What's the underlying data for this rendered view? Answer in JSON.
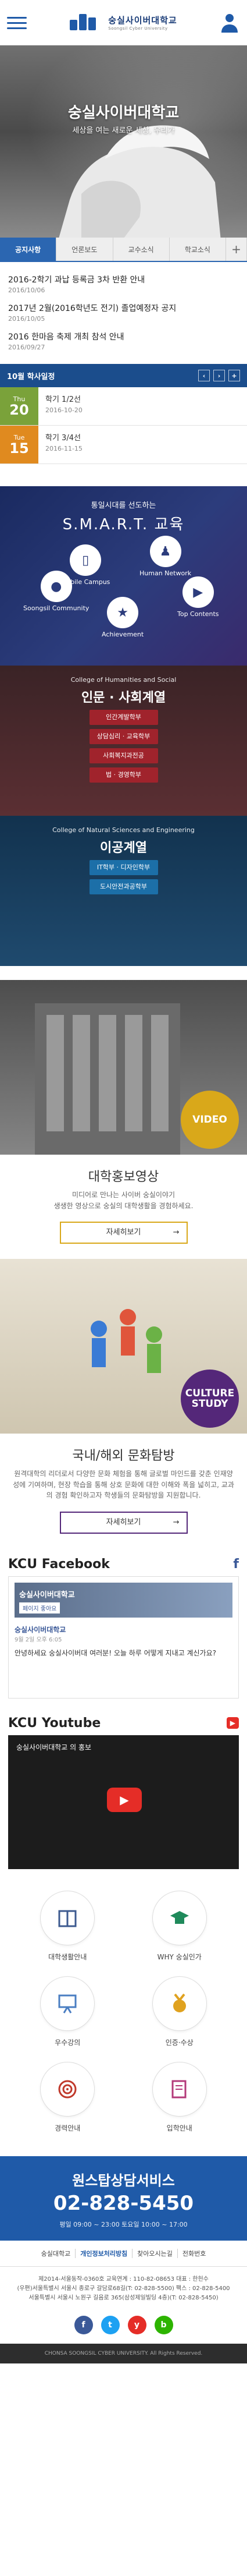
{
  "header": {
    "logo_ko": "숭실사이버대학교",
    "logo_en": "Soongsil Cyber University"
  },
  "hero": {
    "title": "숭실사이버대학교",
    "subtitle": "세상을 여는 새로운 세상, 우리가"
  },
  "tabs": [
    "공지사항",
    "언론보도",
    "교수소식",
    "학교소식",
    "+"
  ],
  "notices": [
    {
      "title": "2016-2학기 과납 등록금 3차 반환 안내",
      "date": "2016/10/06"
    },
    {
      "title": "2017년 2월(2016학년도 전기) 졸업예정자 공지",
      "date": "2016/10/05"
    },
    {
      "title": "2016 한마음 축제 개최 참석 안내",
      "date": "2016/09/27"
    }
  ],
  "schedule": {
    "title": "10월 학사일정",
    "items": [
      {
        "weekday": "Thu",
        "day": "20",
        "title": "학기 1/2선",
        "date": "2016-10-20",
        "color": "#7aa23a"
      },
      {
        "weekday": "Tue",
        "day": "15",
        "title": "학기 3/4선",
        "date": "2016-11-15",
        "color": "#e08a1f"
      }
    ]
  },
  "smart": {
    "line1": "통일시대를 선도하는",
    "line2": "S.M.A.R.T. 교육",
    "items": [
      "Soongsil Community",
      "Mobile Campus",
      "Achievement",
      "Human Network",
      "Top Contents"
    ]
  },
  "college1": {
    "en": "College of Humanities and Social",
    "ko": "인문 · 사회계열",
    "buttons": [
      "인간계발학부",
      "상담심리 · 교육학부",
      "사회복지과전공",
      "법 · 경영학부"
    ]
  },
  "college2": {
    "en": "College of Natural Sciences and Engineering",
    "ko": "이공계열",
    "buttons": [
      "IT학부 · 디자인학부",
      "도시안전과공학부"
    ]
  },
  "video": {
    "badge": "VIDEO",
    "title": "대학홍보영상",
    "desc1": "미디어로 만나는 사이버 숭실이야기",
    "desc2": "생생한 영상으로 숭실의 대학생활을 경험하세요.",
    "more": "자세히보기",
    "badge_color": "#d9a81a",
    "btn_color": "#d9a81a"
  },
  "culture": {
    "badge": "CULTURE STUDY",
    "title": "국내/해외 문화탐방",
    "desc": "원격대학의 리더로서 다양한 문화 체험을 통해 글로벌 마인드를 갖춘 인재양성에 기여하며, 현장 학습을 통해 상호 문화에 대한 이해와 폭을 넓히고, 교과의 경험 확인하고자 학생들의 문화탐방을 지원합니다.",
    "more": "자세히보기",
    "badge_color": "#542779",
    "btn_color": "#542779"
  },
  "facebook": {
    "title": "KCU Facebook",
    "page": "숭실사이버대학교",
    "like": "페이지 좋아요",
    "post_name": "숭실사이버대학교",
    "post_time": "9월 2일 오후 6:05",
    "post_text": "안녕하세요 숭실사이버대 여러분! 오늘 하루 어떻게 지내고 계신가요?"
  },
  "youtube": {
    "title": "KCU Youtube",
    "video_title": "숭실사이버대학교 의 홍보"
  },
  "quicklinks": [
    "대학생활안내",
    "WHY 숭실인가",
    "우수강의",
    "인증·수상",
    "경력안내",
    "입학안내"
  ],
  "cs": {
    "title": "원스탑상담서비스",
    "phone": "02-828-5450",
    "hours": "평일 09:00 ~ 23:00  토요일 10:00 ~ 17:00"
  },
  "footer": {
    "nav": [
      "숭실대학교",
      "개인정보처리방침",
      "찾아오시는길",
      "전화번호"
    ],
    "addr1": "제2014-서울동작-0360호 교육연계 : 110-82-08653 대표 : 한헌수",
    "addr2": "(우편)서울특별시 서울시 종로구 갈담로68길(T: 02-828-5500) 팩스 : 02-828-5400",
    "addr3": "서울특별시 서울시 노원구 길음로 365(삼성제일빌딩 4층)(T: 02-828-5450)",
    "copyright": "CHONSA SOONGSIL CYBER UNIVERSITY. All Rights Reserved.",
    "social": [
      "f",
      "t",
      "y",
      "b"
    ]
  }
}
